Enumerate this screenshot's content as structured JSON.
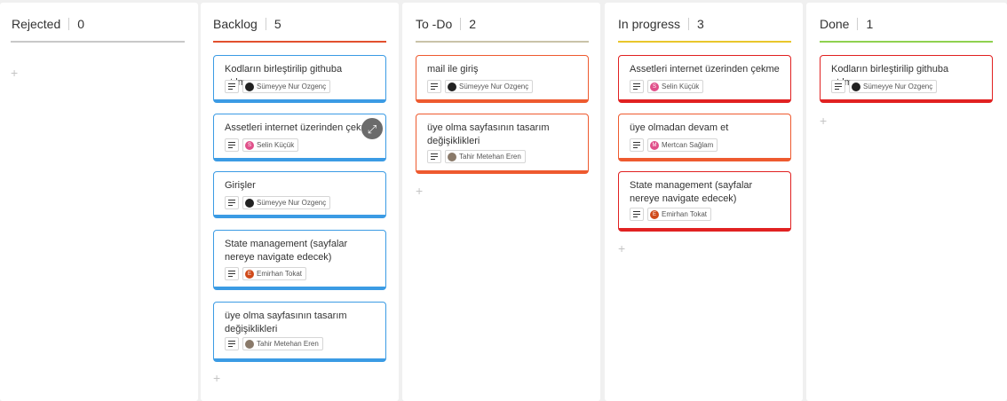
{
  "columns": [
    {
      "title": "Rejected",
      "count": "0",
      "accent": "#c8c8c8"
    },
    {
      "title": "Backlog",
      "count": "5",
      "accent": "#e2502e"
    },
    {
      "title": "To -Do",
      "count": "2",
      "accent": "#c9c3a8"
    },
    {
      "title": "In progress",
      "count": "3",
      "accent": "#e9c62b"
    },
    {
      "title": "Done",
      "count": "1",
      "accent": "#8fd14f"
    }
  ],
  "add_label": "+",
  "expand_icon": "expand-arrows-icon",
  "colors": {
    "backlog_card": "#3b9be4",
    "todo_card": "#ee5a2f",
    "inprogress_card": "#e12121",
    "done_card": "#e12121"
  },
  "assignees": {
    "sumeyye": {
      "name": "Sümeyye Nur Ozgenç",
      "avatar_color": "#222222"
    },
    "selin": {
      "name": "Selin Küçük",
      "avatar_color": "#e0508a"
    },
    "emirhan": {
      "name": "Emirhan Tokat",
      "avatar_color": "#d04a1a"
    },
    "tahir": {
      "name": "Tahir Metehan Eren",
      "avatar_color": "#8a7a6a"
    },
    "mertcan": {
      "name": "Mertcan Sağlam",
      "avatar_color": "#e0508a"
    }
  },
  "cards": {
    "backlog": [
      {
        "title": "Kodların birleştirilip githuba atılması"
      },
      {
        "title": "Assetleri internet üzerinden çekme"
      },
      {
        "title": "Girişler"
      },
      {
        "title": "State management (sayfalar nereye navigate edecek)"
      },
      {
        "title": "üye olma sayfasının tasarım değişiklikleri"
      }
    ],
    "todo": [
      {
        "title": "mail ile giriş"
      },
      {
        "title": "üye olma sayfasının tasarım değişiklikleri"
      }
    ],
    "inprogress": [
      {
        "title": "Assetleri internet üzerinden çekme"
      },
      {
        "title": "üye olmadan devam et"
      },
      {
        "title": "State management (sayfalar nereye navigate edecek)"
      }
    ],
    "done": [
      {
        "title": "Kodların birleştirilip githuba atılması"
      }
    ]
  }
}
